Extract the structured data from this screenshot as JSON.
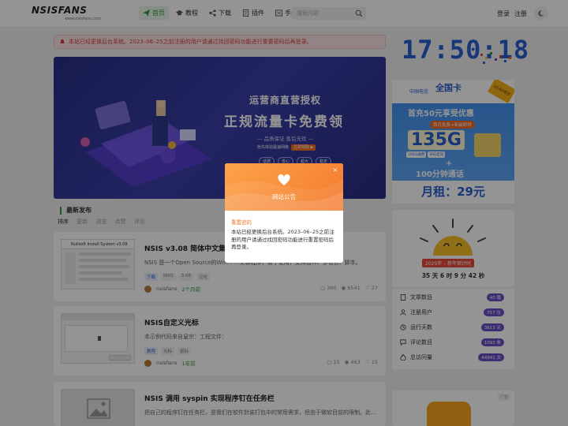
{
  "header": {
    "logo": "NSISFANS",
    "logo_sub": "www.nsisfans.com",
    "nav": [
      {
        "label": "首页",
        "icon": "paper-plane-icon"
      },
      {
        "label": "教程",
        "icon": "graduation-cap-icon"
      },
      {
        "label": "下载",
        "icon": "share-nodes-icon"
      },
      {
        "label": "插件",
        "icon": "file-icon"
      },
      {
        "label": "手册",
        "icon": "book-icon"
      }
    ],
    "search_placeholder": "搜索内容",
    "login": "登录",
    "register": "注册"
  },
  "notice": {
    "text": "本站已经更换后台系统。2023–06–25之前注册的用户请通过找回密码功能进行重置密码后再登录。"
  },
  "banner": {
    "line1": "运营商直营授权",
    "line2": "正规流量卡免费领",
    "line3": "— 品质保证 售后无忧 —",
    "line4": "抢先体验最速网络",
    "line4_tag": "立即领取 ▶",
    "pills": [
      "话费",
      "省心",
      "超大",
      "稳定"
    ]
  },
  "section": {
    "title": "最新发布",
    "sort": [
      "排序",
      "更新",
      "浏览",
      "点赞",
      "评论"
    ]
  },
  "posts": [
    {
      "title": "NSIS v3.08 简体中文集成",
      "excerpt": "NSIS 是一个Open Source的Win… …安装程序，易于使用，支持插件、多语言、脚本。",
      "tags": [
        "下载",
        "NSIS",
        "3.08",
        "汉化"
      ],
      "author": "nsisfans",
      "time": "2个月前",
      "comments": "360",
      "views": "6541",
      "likes": "27",
      "thumb_caption": "Nullsoft Install System v3.08"
    },
    {
      "title": "NSIS自定义光标",
      "excerpt": "本示例代码来自皇宗：工程文件：",
      "tags": [
        "教程",
        "光标",
        "鼠标"
      ],
      "author": "nsisfans",
      "time": "1年前",
      "comments": "15",
      "views": "463",
      "likes": "15"
    },
    {
      "title": "NSIS 调用 syspin 实现程序钉在任务栏",
      "excerpt": "把自己的程序钉在任务栏，是我们在软件封装打包中的常用需求，但由于微软目前的限制。此…",
      "tags": [],
      "author": "",
      "time": ""
    }
  ],
  "sidebar": {
    "clock": "17:50:18",
    "ad": {
      "brand": "中国电信",
      "head": "全国卡",
      "corner": "18-60周岁",
      "line1": "首充50元享受优惠",
      "badge": "首月免费+新装即领",
      "big": "135G",
      "small": [
        "105G通用",
        "30G定向"
      ],
      "plus": "+",
      "call": "100分钟通话",
      "rent": "月租：29元"
    },
    "countdown": {
      "title": "2025年 – 新年倒计时",
      "value": "35 天 6 时 9 分 42 秒"
    },
    "stats": [
      {
        "label": "文章数目",
        "value": "40 篇",
        "icon": "file-text-icon"
      },
      {
        "label": "注册用户",
        "value": "757 位",
        "icon": "user-icon"
      },
      {
        "label": "运行天数",
        "value": "3613 天",
        "icon": "clock-icon"
      },
      {
        "label": "评论数目",
        "value": "1093 条",
        "icon": "comment-icon"
      },
      {
        "label": "总访问量",
        "value": "44941 次",
        "icon": "fire-icon"
      }
    ],
    "bottom_badge": "广告"
  },
  "modal": {
    "title": "网站公告",
    "subtitle": "重置密码",
    "body": "本站已经更换后台系统。2023–06–25之前注册的用户请通过找回密码功能进行重置密码后再登录。",
    "close": "✕"
  },
  "colors": {
    "accent": "#2f9a3d",
    "notice": "#d43c3c",
    "modal": "#f47a2d",
    "banner": "#2a2f88"
  }
}
